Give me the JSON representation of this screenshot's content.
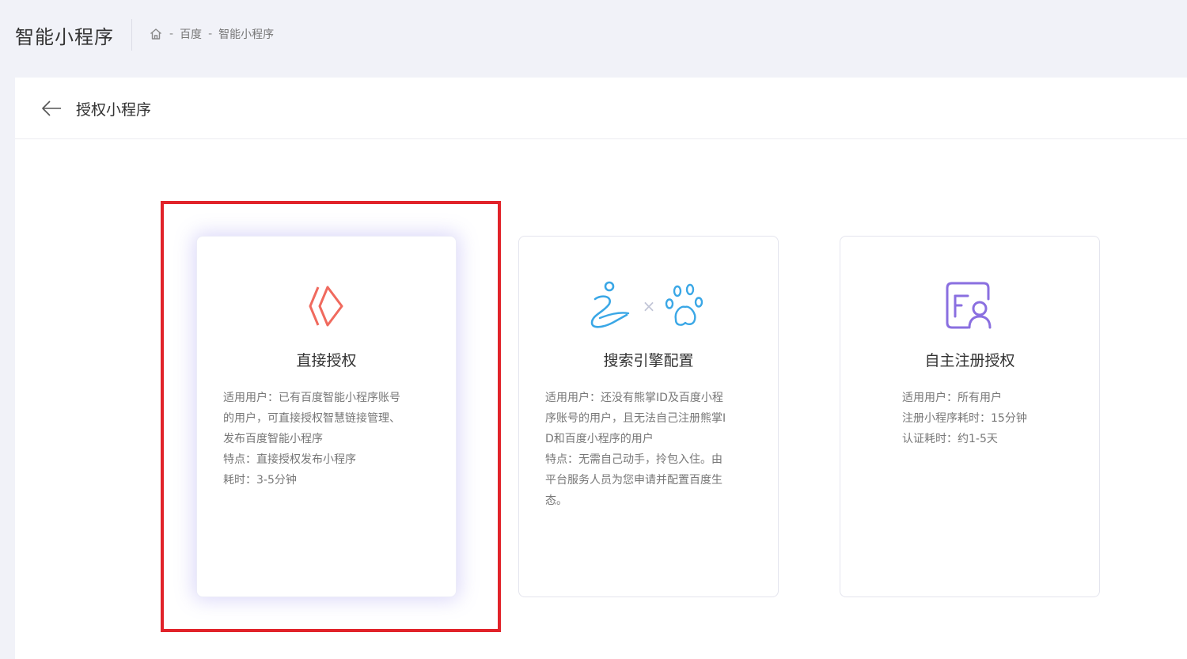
{
  "header": {
    "app_title": "智能小程序",
    "breadcrumb": [
      "百度",
      "智能小程序"
    ],
    "separator": "-"
  },
  "panel": {
    "title": "授权小程序"
  },
  "cards": [
    {
      "title": "直接授权",
      "icon": "diamond-chevron-icon",
      "lines": [
        "适用用户：已有百度智能小程序账号",
        "的用户，可直接授权智慧链接管理、",
        "发布百度智能小程序",
        "特点：直接授权发布小程序",
        "耗时：3-5分钟"
      ],
      "selected": true
    },
    {
      "title": "搜索引擎配置",
      "icon": "xiongzhang-x-baidu-paw-icon",
      "icon_times": "×",
      "lines": [
        "适用用户：还没有熊掌ID及百度小程",
        "序账号的用户，且无法自己注册熊掌I",
        "D和百度小程序的用户",
        "特点：无需自己动手，拎包入住。由",
        "平台服务人员为您申请并配置百度生",
        "态。"
      ],
      "selected": false
    },
    {
      "title": "自主注册授权",
      "icon": "form-user-icon",
      "lines": [
        "适用用户：所有用户",
        "注册小程序耗时：15分钟",
        "认证耗时：约1-5天"
      ],
      "selected": false
    }
  ],
  "colors": {
    "highlight": "#e1232a",
    "icon_red": "#f06a5e",
    "icon_blue": "#3aa7e6",
    "icon_purple": "#8a6fe0"
  }
}
